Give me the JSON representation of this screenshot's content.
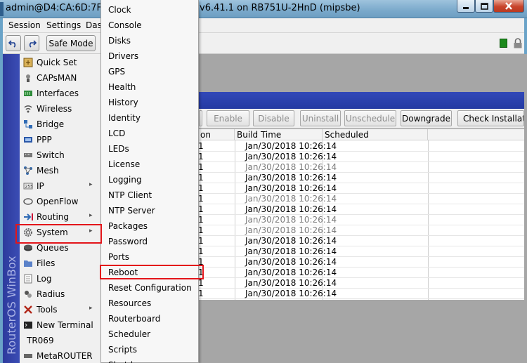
{
  "window": {
    "title_left": "admin@D4:CA:6D:7F:",
    "title_right": "v6.41.1 on RB751U-2HnD (mipsbe)"
  },
  "menubar": [
    "Session",
    "Settings",
    "Das"
  ],
  "toolbar": {
    "undo_icon": "undo-icon",
    "redo_icon": "redo-icon",
    "safe_mode": "Safe Mode"
  },
  "brand": "RouterOS WinBox",
  "left_menu": [
    {
      "label": "Quick Set",
      "icon": "quick-set-icon",
      "submenu": false
    },
    {
      "label": "CAPsMAN",
      "icon": "capsman-icon",
      "submenu": false
    },
    {
      "label": "Interfaces",
      "icon": "interfaces-icon",
      "submenu": false
    },
    {
      "label": "Wireless",
      "icon": "wireless-icon",
      "submenu": false
    },
    {
      "label": "Bridge",
      "icon": "bridge-icon",
      "submenu": false
    },
    {
      "label": "PPP",
      "icon": "ppp-icon",
      "submenu": false
    },
    {
      "label": "Switch",
      "icon": "switch-icon",
      "submenu": false
    },
    {
      "label": "Mesh",
      "icon": "mesh-icon",
      "submenu": false
    },
    {
      "label": "IP",
      "icon": "ip-icon",
      "submenu": true
    },
    {
      "label": "OpenFlow",
      "icon": "openflow-icon",
      "submenu": false
    },
    {
      "label": "Routing",
      "icon": "routing-icon",
      "submenu": true
    },
    {
      "label": "System",
      "icon": "gear-icon",
      "submenu": true
    },
    {
      "label": "Queues",
      "icon": "queues-icon",
      "submenu": false
    },
    {
      "label": "Files",
      "icon": "folder-icon",
      "submenu": false
    },
    {
      "label": "Log",
      "icon": "log-icon",
      "submenu": false
    },
    {
      "label": "Radius",
      "icon": "radius-icon",
      "submenu": false
    },
    {
      "label": "Tools",
      "icon": "tools-icon",
      "submenu": true
    },
    {
      "label": "New Terminal",
      "icon": "terminal-icon",
      "submenu": false
    },
    {
      "label": "TR069",
      "icon": "",
      "submenu": false
    },
    {
      "label": "MetaROUTER",
      "icon": "metarouter-icon",
      "submenu": false
    }
  ],
  "system_menu": [
    "Clock",
    "Console",
    "Disks",
    "Drivers",
    "GPS",
    "Health",
    "History",
    "Identity",
    "LCD",
    "LEDs",
    "License",
    "Logging",
    "NTP Client",
    "NTP Server",
    "Packages",
    "Password",
    "Ports",
    "Reboot",
    "Reset Configuration",
    "Resources",
    "Routerboard",
    "Scheduler",
    "Scripts",
    "Shutdown"
  ],
  "packages": {
    "buttons": {
      "enable": "Enable",
      "disable": "Disable",
      "uninstall": "Uninstall",
      "unschedule": "Unschedule",
      "downgrade": "Downgrade",
      "check": "Check Installation"
    },
    "columns": [
      "on",
      "Build Time",
      "Scheduled"
    ],
    "rows": [
      {
        "v": "1",
        "time": "Jan/30/2018 10:26:14",
        "gray": false
      },
      {
        "v": "1",
        "time": "Jan/30/2018 10:26:14",
        "gray": false
      },
      {
        "v": "1",
        "time": "Jan/30/2018 10:26:14",
        "gray": true
      },
      {
        "v": "1",
        "time": "Jan/30/2018 10:26:14",
        "gray": false
      },
      {
        "v": "1",
        "time": "Jan/30/2018 10:26:14",
        "gray": false
      },
      {
        "v": "1",
        "time": "Jan/30/2018 10:26:14",
        "gray": true
      },
      {
        "v": "1",
        "time": "Jan/30/2018 10:26:14",
        "gray": false
      },
      {
        "v": "1",
        "time": "Jan/30/2018 10:26:14",
        "gray": true
      },
      {
        "v": "1",
        "time": "Jan/30/2018 10:26:14",
        "gray": true
      },
      {
        "v": "1",
        "time": "Jan/30/2018 10:26:14",
        "gray": false
      },
      {
        "v": "1",
        "time": "Jan/30/2018 10:26:14",
        "gray": false
      },
      {
        "v": "1",
        "time": "Jan/30/2018 10:26:14",
        "gray": false
      },
      {
        "v": "1",
        "time": "Jan/30/2018 10:26:14",
        "gray": false
      },
      {
        "v": "1",
        "time": "Jan/30/2018 10:26:14",
        "gray": false
      },
      {
        "v": "1",
        "time": "Jan/30/2018 10:26:14",
        "gray": false
      }
    ]
  },
  "highlight_color": "#e3151a"
}
